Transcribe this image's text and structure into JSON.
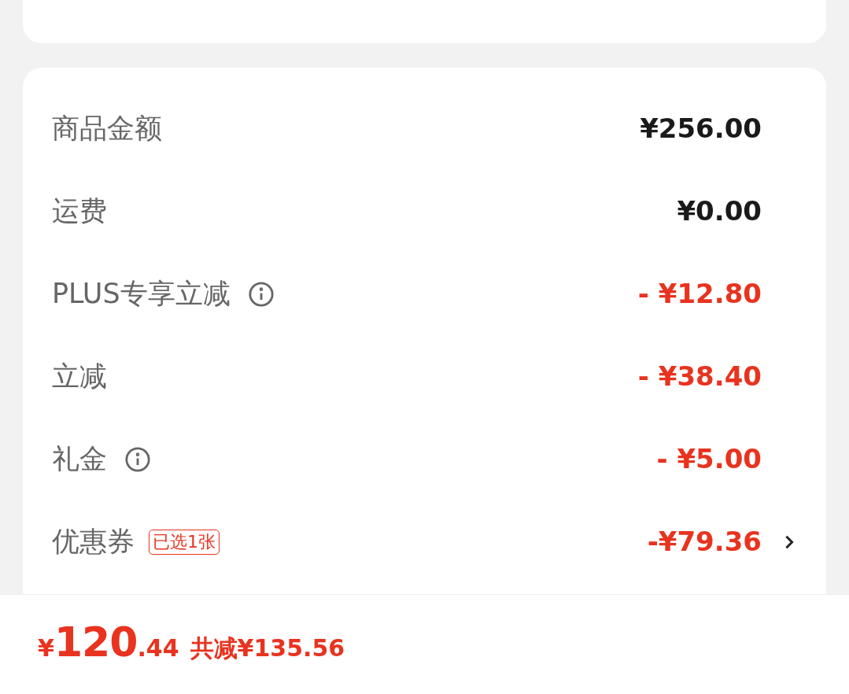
{
  "rows": [
    {
      "label": "商品金额",
      "info": false,
      "value": "¥256.00",
      "kind": "normal",
      "chevron": false
    },
    {
      "label": "运费",
      "info": false,
      "value": "¥0.00",
      "kind": "normal",
      "chevron": false
    },
    {
      "label": "PLUS专享立减",
      "info": true,
      "value": "- ¥12.80",
      "kind": "discount",
      "chevron": false
    },
    {
      "label": "立减",
      "info": false,
      "value": "- ¥38.40",
      "kind": "discount",
      "chevron": false
    },
    {
      "label": "礼金",
      "info": true,
      "value": "- ¥5.00",
      "kind": "discount",
      "chevron": false
    },
    {
      "label": "优惠券",
      "info": false,
      "tag": "已选1张",
      "value": "-¥79.36",
      "kind": "discount",
      "chevron": true
    }
  ],
  "total": {
    "currency": "¥",
    "integer": "120",
    "decimal": ".44",
    "saving": "共减¥135.56"
  }
}
